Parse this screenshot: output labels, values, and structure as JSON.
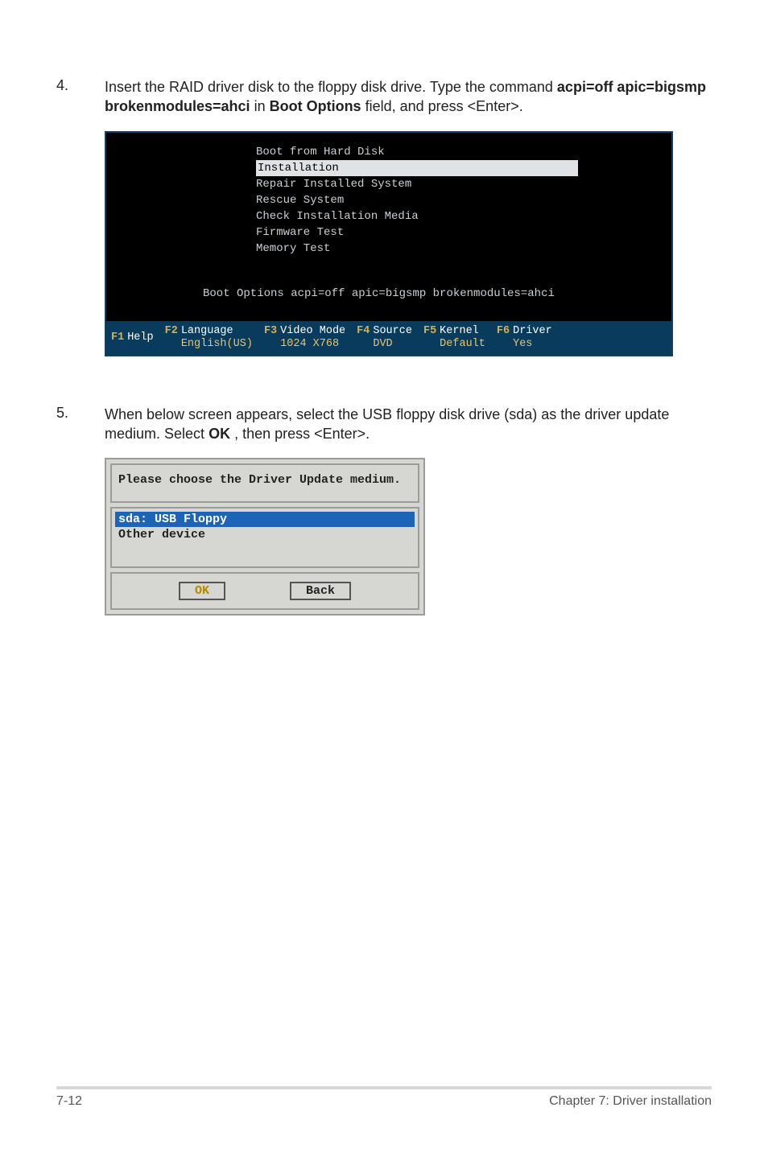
{
  "step4": {
    "num": "4.",
    "text_before": "Insert the RAID driver disk to the floppy disk drive. Type the command ",
    "cmd": "acpi=off apic=bigsmp brokenmodules=ahci",
    "text_mid": " in ",
    "bold2": "Boot Options",
    "text_after": " field, and press <Enter>."
  },
  "boot": {
    "lines": [
      "Boot from Hard Disk",
      "Installation",
      "Repair Installed System",
      "Rescue System",
      "Check Installation Media",
      "Firmware Test",
      "Memory Test"
    ],
    "selected_index": 1,
    "options": "Boot Options acpi=off apic=bigsmp brokenmodules=ahci",
    "fkeys": [
      {
        "key": "F1",
        "label": "Help",
        "sub": ""
      },
      {
        "key": "F2",
        "label": "Language",
        "sub": "English(US)"
      },
      {
        "key": "F3",
        "label": "Video Mode",
        "sub": "1024 X768"
      },
      {
        "key": "F4",
        "label": "Source",
        "sub": "DVD"
      },
      {
        "key": "F5",
        "label": "Kernel",
        "sub": "Default"
      },
      {
        "key": "F6",
        "label": "Driver",
        "sub": "Yes"
      }
    ]
  },
  "step5": {
    "num": "5.",
    "text_before": "When below screen appears, select the USB floppy disk drive (sda) as the driver update medium. Select ",
    "bold": "OK",
    "text_after": ", then press <Enter>."
  },
  "dialog": {
    "title": "Please choose the Driver Update medium.",
    "items": [
      {
        "label": "sda: USB Floppy",
        "selected": true
      },
      {
        "label": "Other device",
        "selected": false
      }
    ],
    "ok": "OK",
    "back": "Back"
  },
  "footer": {
    "left": "7-12",
    "right": "Chapter 7: Driver installation"
  }
}
